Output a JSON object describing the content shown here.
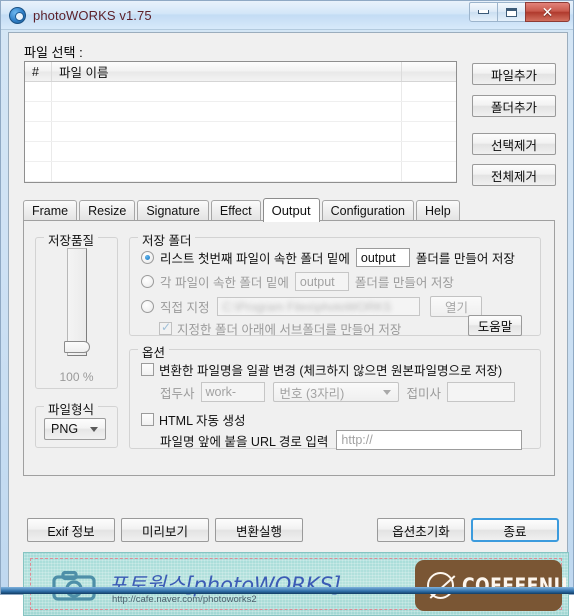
{
  "window": {
    "title": "photoWORKS v1.75",
    "icon": "camera-icon",
    "minimize_label": "",
    "maximize_label": "",
    "close_label": "✕",
    "accent_blue": "#3c9bdd",
    "titlebar_text_color": "#5c1f28"
  },
  "file_section": {
    "label": "파일 선택 :",
    "columns": [
      "#",
      "파일 이름"
    ],
    "rows": [],
    "buttons": [
      {
        "label": "파일추가",
        "name": "add-file-button"
      },
      {
        "label": "폴더추가",
        "name": "add-folder-button"
      },
      {
        "label": "선택제거",
        "name": "remove-selected-button"
      },
      {
        "label": "전체제거",
        "name": "remove-all-button"
      }
    ]
  },
  "tabs": [
    {
      "label": "Frame",
      "active": false
    },
    {
      "label": "Resize",
      "active": false
    },
    {
      "label": "Signature",
      "active": false
    },
    {
      "label": "Effect",
      "active": false
    },
    {
      "label": "Output",
      "active": true
    },
    {
      "label": "Configuration",
      "active": false
    },
    {
      "label": "Help",
      "active": false
    }
  ],
  "output_tab": {
    "quality_group": {
      "title": "저장품질",
      "percent": "100 %",
      "slider_position_label": "100 %"
    },
    "format_group": {
      "title": "파일형식",
      "selected": "PNG"
    },
    "folder_group": {
      "title": "저장 폴더",
      "option1": {
        "radio_checked": true,
        "text_before": "리스트 첫번째 파일이 속한 폴더 밑에",
        "field_value": "output",
        "text_after": "폴더를 만들어 저장"
      },
      "option2": {
        "radio_checked": false,
        "text_before": "각 파일이 속한 폴더 밑에",
        "field_value": "output",
        "text_after": "폴더를 만들어 저장"
      },
      "option3": {
        "radio_checked": false,
        "text_before": "직접 지정",
        "path_value": "C:\\Program Files\\photoWORKS",
        "open_button": "열기"
      },
      "subfolder_checkbox": {
        "checked": true,
        "label": "지정한 폴더 아래에 서브폴더를 만들어 저장"
      },
      "help_button": "도움말"
    },
    "options_group": {
      "title": "옵션",
      "rename": {
        "checked": false,
        "label": "변환한 파일명을 일괄 변경 (체크하지 않으면 원본파일명으로 저장)",
        "prefix_label": "접두사",
        "prefix_placeholder": "work-",
        "number_select": "번호 (3자리)",
        "suffix_label": "접미사",
        "suffix_value": ""
      },
      "html": {
        "checked": false,
        "label": "HTML 자동 생성",
        "url_label": "파일명 앞에 붙을 URL 경로 입력",
        "url_placeholder": "http://"
      }
    }
  },
  "bottom_buttons": {
    "left": [
      {
        "label": "Exif 정보",
        "name": "exif-info-button"
      },
      {
        "label": "미리보기",
        "name": "preview-button"
      },
      {
        "label": "변환실행",
        "name": "run-convert-button"
      }
    ],
    "right": [
      {
        "label": "옵션초기화",
        "name": "reset-options-button",
        "focused": false
      },
      {
        "label": "종료",
        "name": "exit-button",
        "focused": true
      }
    ]
  },
  "banner": {
    "brand_korean": "포토웍스[photoWORKS]",
    "url": "http://cafe.naver.com/photoworks2",
    "sponsor": "COFFEENUT",
    "bg_color": "#a6dcd9",
    "sponsor_color": "#7a5634"
  }
}
